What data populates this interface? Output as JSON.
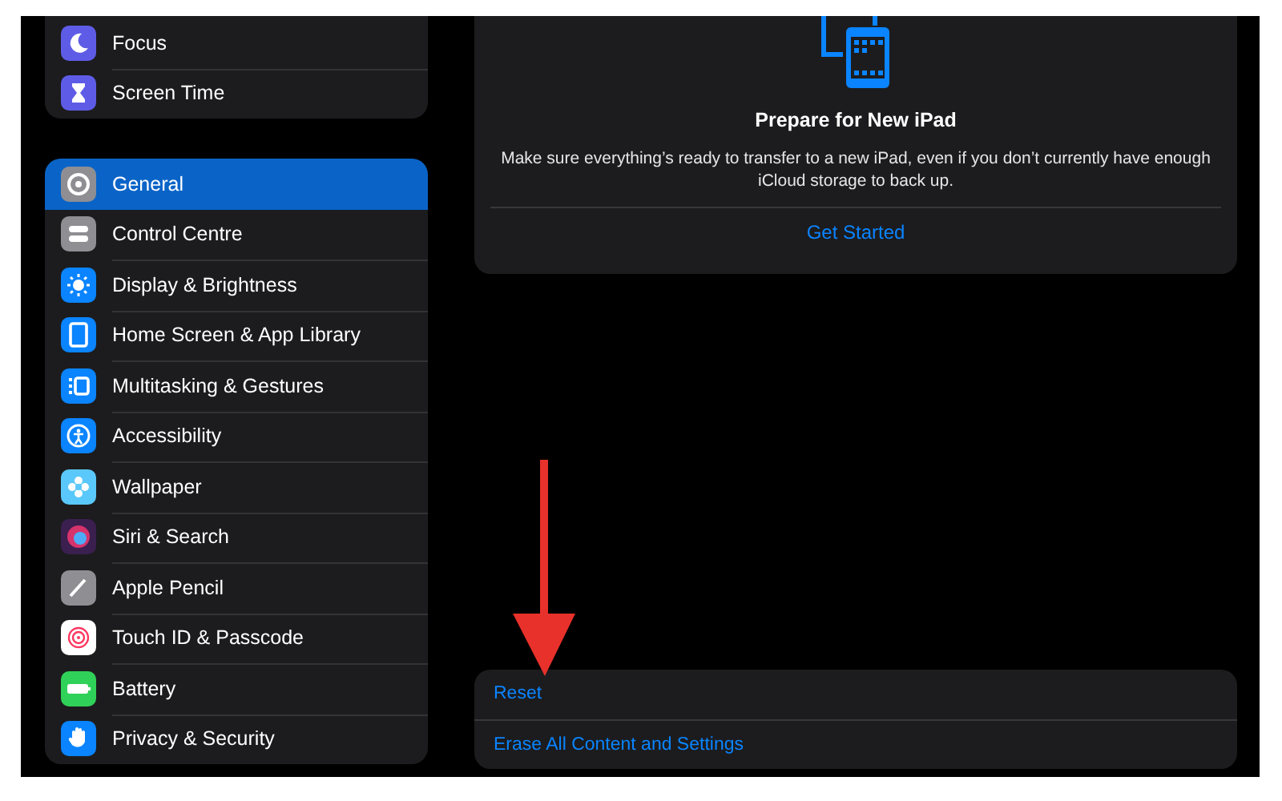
{
  "sidebar": {
    "groups": [
      {
        "items": [
          {
            "label": "Focus",
            "selected": false,
            "kind": "moon",
            "color": "#5e5ce6"
          },
          {
            "label": "Screen Time",
            "selected": false,
            "kind": "hourglass",
            "color": "#5e5ce6"
          }
        ]
      },
      {
        "items": [
          {
            "label": "General",
            "selected": true,
            "kind": "gear",
            "color": "#8e8e93"
          },
          {
            "label": "Control Centre",
            "selected": false,
            "kind": "toggles",
            "color": "#8e8e93"
          },
          {
            "label": "Display & Brightness",
            "selected": false,
            "kind": "sun",
            "color": "#0a84ff"
          },
          {
            "label": "Home Screen & App Library",
            "selected": false,
            "kind": "homescreen",
            "color": "#0a84ff"
          },
          {
            "label": "Multitasking & Gestures",
            "selected": false,
            "kind": "multitask",
            "color": "#0a84ff"
          },
          {
            "label": "Accessibility",
            "selected": false,
            "kind": "accessibility",
            "color": "#0a84ff"
          },
          {
            "label": "Wallpaper",
            "selected": false,
            "kind": "flower",
            "color": "#5ac8fa"
          },
          {
            "label": "Siri & Search",
            "selected": false,
            "kind": "siri",
            "color": "#3a1f4f"
          },
          {
            "label": "Apple Pencil",
            "selected": false,
            "kind": "pencil",
            "color": "#8e8e93"
          },
          {
            "label": "Touch ID & Passcode",
            "selected": false,
            "kind": "fingerprint",
            "color": "#ffffff"
          },
          {
            "label": "Battery",
            "selected": false,
            "kind": "battery",
            "color": "#30d158"
          },
          {
            "label": "Privacy & Security",
            "selected": false,
            "kind": "hand",
            "color": "#0a84ff"
          }
        ]
      }
    ]
  },
  "transfer_card": {
    "title": "Prepare for New iPad",
    "description": "Make sure everything’s ready to transfer to a new iPad, even if you don’t currently have enough iCloud storage to back up.",
    "action": "Get Started"
  },
  "reset_card": {
    "actions": [
      "Reset",
      "Erase All Content and Settings"
    ]
  }
}
